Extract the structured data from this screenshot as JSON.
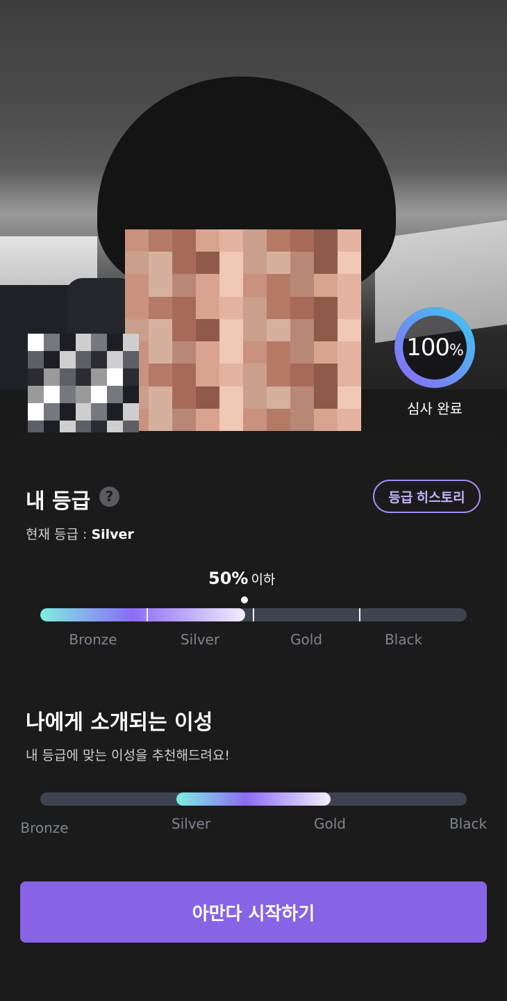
{
  "profile": {
    "review_progress": 100,
    "review_progress_number": "100",
    "review_progress_unit": "%",
    "review_status": "심사 완료"
  },
  "my_grade": {
    "title": "내 등급",
    "help_icon": "question-icon",
    "history_button": "등급 히스토리",
    "current_label": "현재 등급 : ",
    "current_value": "Silver",
    "percentile_value": "50%",
    "percentile_suffix": "이하",
    "bar_fill_fraction": 0.48,
    "tiers": [
      "Bronze",
      "Silver",
      "Gold",
      "Black"
    ]
  },
  "intro": {
    "title": "나에게 소개되는 이성",
    "subtitle": "내 등급에 맞는 이성을 추천해드려요!",
    "range_start_fraction": 0.32,
    "range_end_fraction": 0.68,
    "tiers": [
      "Bronze",
      "Silver",
      "Gold",
      "Black"
    ]
  },
  "cta": {
    "start_button": "아만다 시작하기"
  },
  "colors": {
    "accent": "#8763e6",
    "outline_accent": "#a78bfa",
    "gradient_start": "#7eeee0",
    "gradient_mid": "#8b6cf6",
    "track": "#3e444f",
    "background": "#1b1b1b"
  }
}
